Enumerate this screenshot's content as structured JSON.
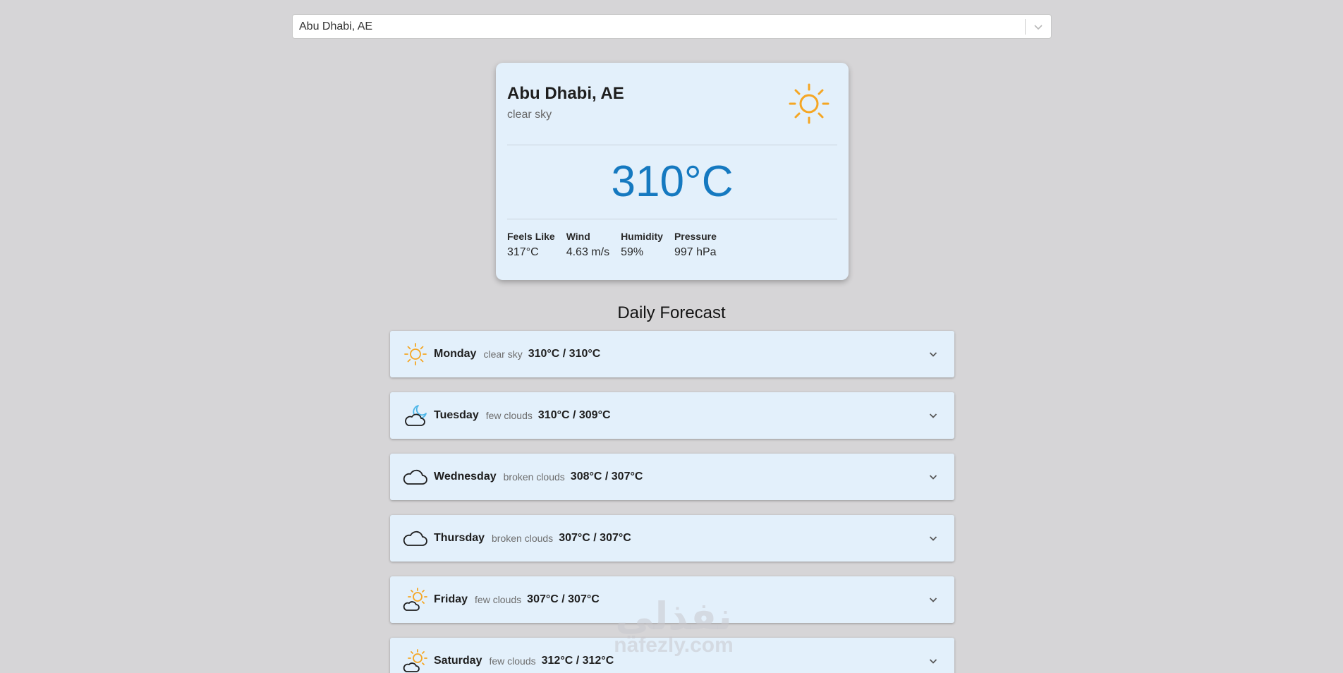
{
  "search": {
    "value": "Abu Dhabi, AE"
  },
  "current": {
    "city": "Abu Dhabi, AE",
    "description": "clear sky",
    "icon": "sun-icon",
    "temperature": "310°C",
    "details": [
      {
        "label": "Feels Like",
        "value": "317°C"
      },
      {
        "label": "Wind",
        "value": "4.63 m/s"
      },
      {
        "label": "Humidity",
        "value": "59%"
      },
      {
        "label": "Pressure",
        "value": "997 hPa"
      }
    ]
  },
  "forecast": {
    "title": "Daily Forecast",
    "days": [
      {
        "day": "Monday",
        "description": "clear sky",
        "temps": "310°C / 310°C",
        "icon": "sun-icon"
      },
      {
        "day": "Tuesday",
        "description": "few clouds",
        "temps": "310°C / 309°C",
        "icon": "moon-cloud-icon"
      },
      {
        "day": "Wednesday",
        "description": "broken clouds",
        "temps": "308°C / 307°C",
        "icon": "cloud-icon"
      },
      {
        "day": "Thursday",
        "description": "broken clouds",
        "temps": "307°C / 307°C",
        "icon": "cloud-icon"
      },
      {
        "day": "Friday",
        "description": "few clouds",
        "temps": "307°C / 307°C",
        "icon": "sun-cloud-icon"
      },
      {
        "day": "Saturday",
        "description": "few clouds",
        "temps": "312°C / 312°C",
        "icon": "sun-cloud-icon"
      }
    ]
  },
  "watermark": {
    "arabic": "نفذلي",
    "latin": "nafezly.com"
  },
  "colors": {
    "background": "#d6d5d7",
    "card": "#e3f0fb",
    "temperature": "#1579c0",
    "sun": "#f5a623",
    "moon": "#4db6e8"
  }
}
